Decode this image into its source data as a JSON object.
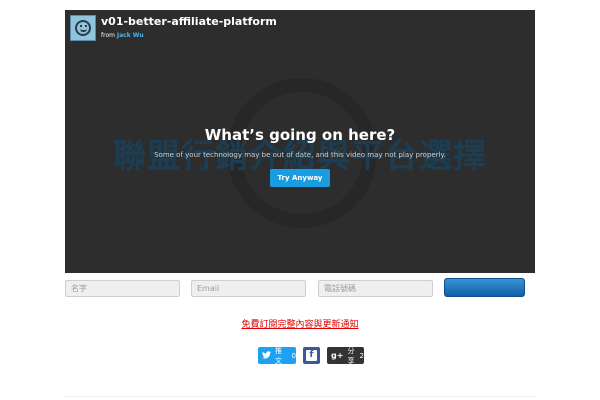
{
  "video": {
    "title": "v01-better-affiliate-platform",
    "from_label": "from",
    "author": "Jack Wu",
    "background_text": "聯盟行銷介紹與平台選擇",
    "overlay_title": "What’s going on here?",
    "overlay_message": "Some of your technology may be out of date, and this video may not play properly.",
    "try_button": "Try Anyway"
  },
  "form": {
    "name_placeholder": "名字",
    "email_placeholder": "Email",
    "phone_placeholder": "電話號碼",
    "submit_label": ""
  },
  "red_link": "免費訂閱完整內容與更新通知",
  "share": {
    "twitter_icon": "twitter-bird",
    "twitter_label": "推文",
    "twitter_count": "0",
    "facebook_icon": "f",
    "gplus_icon": "g+",
    "gplus_label": "分享",
    "gplus_count": "2"
  },
  "colors": {
    "player_bg": "#2d2d2d",
    "accent_blue": "#1a9de0",
    "link_red": "#e00000",
    "twitter": "#1da1f2",
    "facebook": "#3b5998"
  }
}
